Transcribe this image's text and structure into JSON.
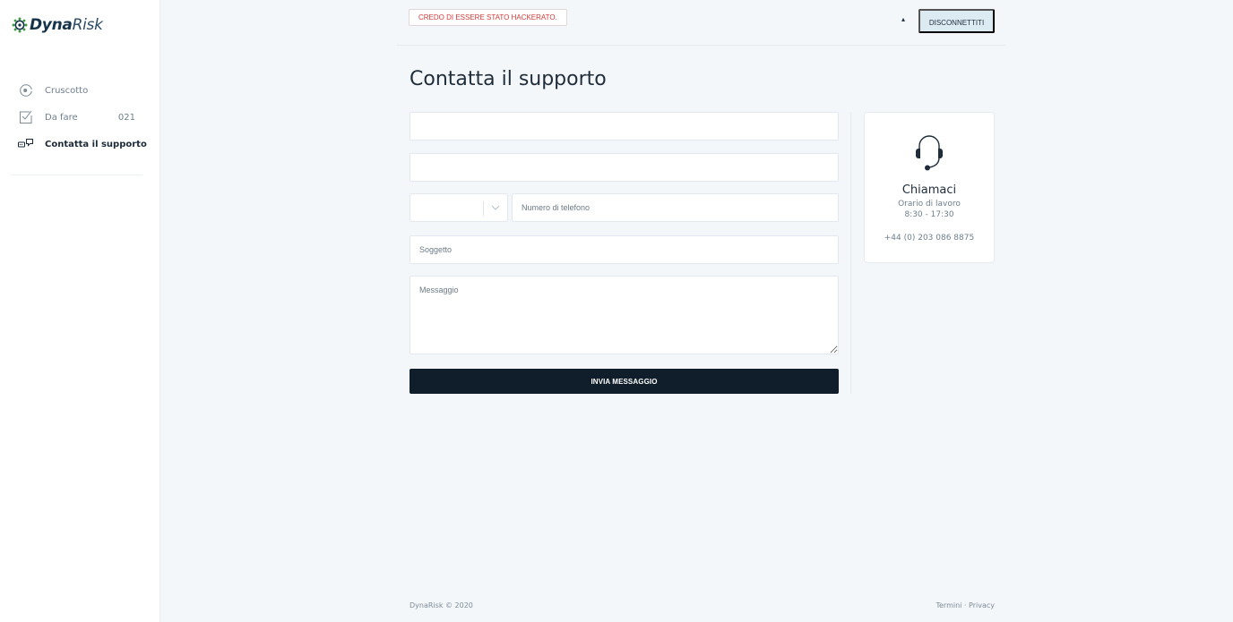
{
  "brand": {
    "name_bold": "Dyna",
    "name_light": "Risk"
  },
  "sidebar": {
    "items": [
      {
        "label": "Cruscotto",
        "icon": "dashboard-icon"
      },
      {
        "label": "Da fare",
        "count": "021",
        "icon": "checklist-icon"
      },
      {
        "label": "Contatta il supporto",
        "icon": "chat-bubbles-icon",
        "active": true
      }
    ]
  },
  "topbar": {
    "hacked_label": "CREDO DI ESSERE STATO HACKERATO.",
    "caret": "▴",
    "logout_label": "DISCONNETTITI"
  },
  "page": {
    "title": "Contatta il supporto"
  },
  "form": {
    "name_value": "",
    "email_value": "",
    "country_code_value": "",
    "phone_placeholder": "Numero di telefono",
    "subject_placeholder": "Soggetto",
    "message_placeholder": "Messaggio",
    "submit_label": "INVIA MESSAGGIO"
  },
  "call": {
    "title": "Chiamaci",
    "hours_label": "Orario di lavoro",
    "hours": "8:30 - 17:30",
    "phone": "+44 (0) 203 086 8875"
  },
  "footer": {
    "copyright": "DynaRisk © 2020",
    "terms": "Termini",
    "separator": "·",
    "privacy": "Privacy"
  },
  "colors": {
    "accent_dark": "#0f1e2a",
    "danger": "#d23a3a",
    "logout_bg": "#dcebf2",
    "logo_green": "#3e9a3e"
  }
}
